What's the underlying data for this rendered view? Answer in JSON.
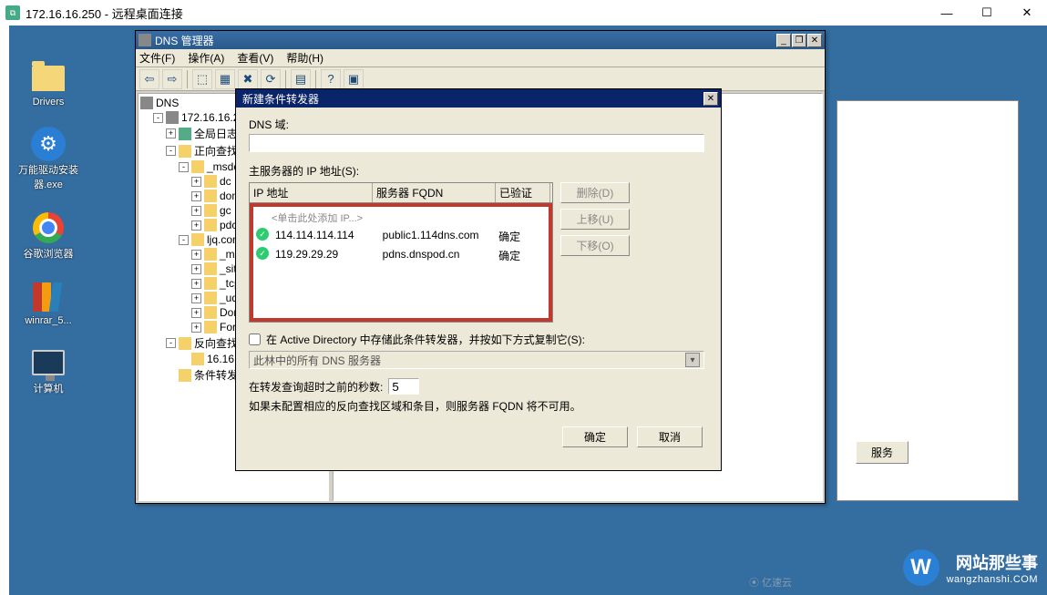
{
  "outer": {
    "title": "172.16.16.250 - 远程桌面连接",
    "min": "—",
    "max": "☐",
    "close": "✕"
  },
  "desktop_icons": {
    "drivers": "Drivers",
    "driver_exe": "万能驱动安装器.exe",
    "chrome": "谷歌浏览器",
    "winrar": "winrar_5...",
    "computer": "计算机"
  },
  "dns_window": {
    "title": "DNS 管理器",
    "menu": {
      "file": "文件(F)",
      "action": "操作(A)",
      "view": "查看(V)",
      "help": "帮助(H)"
    },
    "tree": {
      "root": "DNS",
      "server": "172.16.16.250",
      "global_log": "全局日志",
      "fwd_zones": "正向查找区域",
      "msdcs": "_msdcs.lj...",
      "msdcs_children": [
        "dc",
        "domain...",
        "gc",
        "pdc"
      ],
      "ljq": "ljq.com",
      "ljq_children": [
        "_msdcs",
        "_sites",
        "_tcp",
        "_udp",
        "Domain...",
        "Forest..."
      ],
      "rev_zones": "反向查找区域",
      "rev_child": "16.16.172...",
      "cond_fwd": "条件转发器"
    }
  },
  "dialog": {
    "title": "新建条件转发器",
    "dns_domain_label": "DNS 域:",
    "master_servers_label": "主服务器的 IP 地址(S):",
    "columns": {
      "ip": "IP 地址",
      "fqdn": "服务器 FQDN",
      "validated": "已验证"
    },
    "hint_row": "<单击此处添加 IP...>",
    "rows": [
      {
        "ip": "114.114.114.114",
        "fqdn": "public1.114dns.com",
        "validated": "确定"
      },
      {
        "ip": "119.29.29.29",
        "fqdn": "pdns.dnspod.cn",
        "validated": "确定"
      }
    ],
    "btn_delete": "删除(D)",
    "btn_up": "上移(U)",
    "btn_down": "下移(O)",
    "chk_ad": "在 Active Directory 中存储此条件转发器，并按如下方式复制它(S):",
    "combo": "此林中的所有 DNS 服务器",
    "timeout_label": "在转发查询超时之前的秒数:",
    "timeout_value": "5",
    "reverse_warn": "如果未配置相应的反向查找区域和条目，则服务器 FQDN 将不可用。",
    "ok": "确定",
    "cancel": "取消"
  },
  "back_panel": {
    "btn_services": "服务"
  },
  "watermark": {
    "badge": "W",
    "title": "网站那些事",
    "url": "wangzhanshi.COM",
    "yisu": "⦿ 亿速云"
  }
}
